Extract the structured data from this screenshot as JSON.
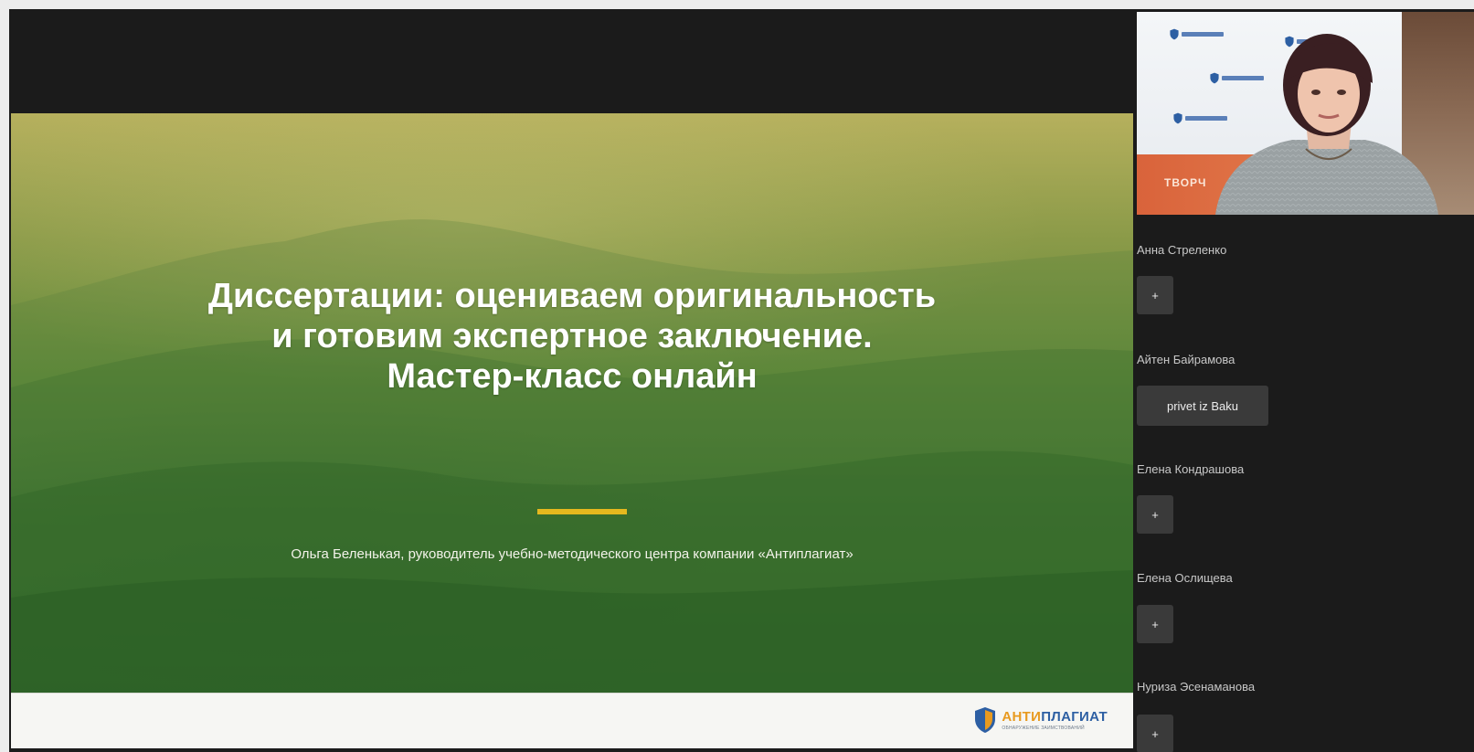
{
  "slide": {
    "title_lines": [
      "Диссертации: оцениваем оригинальность",
      "и готовим экспертное заключение.",
      "Мастер-класс онлайн"
    ],
    "subtitle": "Ольга Беленькая, руководитель учебно-методического центра компании «Антиплагиат»",
    "logo": {
      "brand_prefix": "АНТИ",
      "brand_suffix": "ПЛАГИАТ",
      "tagline": "ОБНАРУЖЕНИЕ ЗАИМСТВОВАНИЙ"
    },
    "divider_color": "#e5b81e"
  },
  "webcam": {
    "banner_text": "ТВОРЧ"
  },
  "chat": {
    "messages": [
      {
        "author": "Анна Стреленко",
        "text": "+"
      },
      {
        "author": "Айтен Байрамова",
        "text": "privet iz Baku"
      },
      {
        "author": "Елена Кондрашова",
        "text": "+"
      },
      {
        "author": "Елена Ослищева",
        "text": "+"
      },
      {
        "author": "Нуриза Эсенаманова",
        "text": "+"
      }
    ]
  },
  "colors": {
    "background": "#1b1b1b",
    "chat_bubble": "#3a3a3a",
    "brand_blue": "#2d5fa3",
    "brand_orange": "#e89a1f"
  }
}
